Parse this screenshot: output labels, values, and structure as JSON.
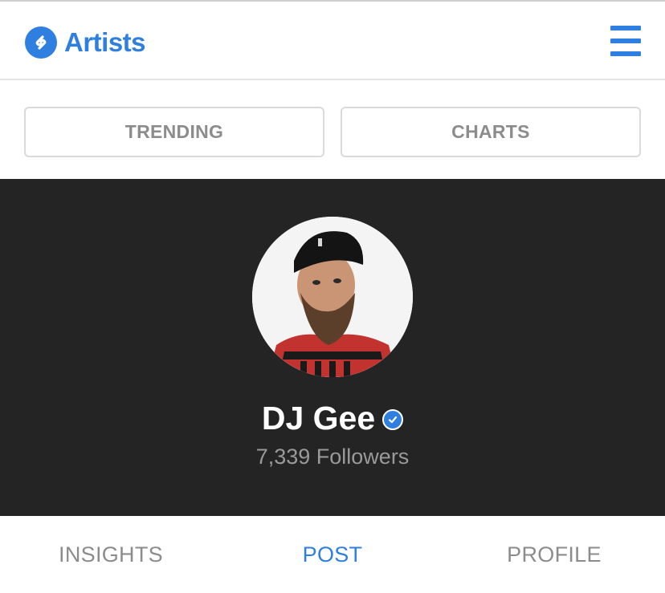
{
  "colors": {
    "accent": "#2f7fe0",
    "hero_bg": "#242424",
    "muted_text": "#8c8c8c",
    "followers_text": "#9a9a9a"
  },
  "header": {
    "logo_icon": "shazam-logo-icon",
    "title": "Artists",
    "menu_icon": "hamburger-menu-icon"
  },
  "segments": {
    "trending_label": "TRENDING",
    "charts_label": "CHARTS"
  },
  "profile": {
    "avatar_icon": "artist-avatar",
    "name": "DJ Gee",
    "verified_icon": "verified-badge-icon",
    "followers_count": "7,339",
    "followers_label": "Followers"
  },
  "tabs": [
    {
      "label": "INSIGHTS",
      "active": false
    },
    {
      "label": "POST",
      "active": true
    },
    {
      "label": "PROFILE",
      "active": false
    }
  ]
}
